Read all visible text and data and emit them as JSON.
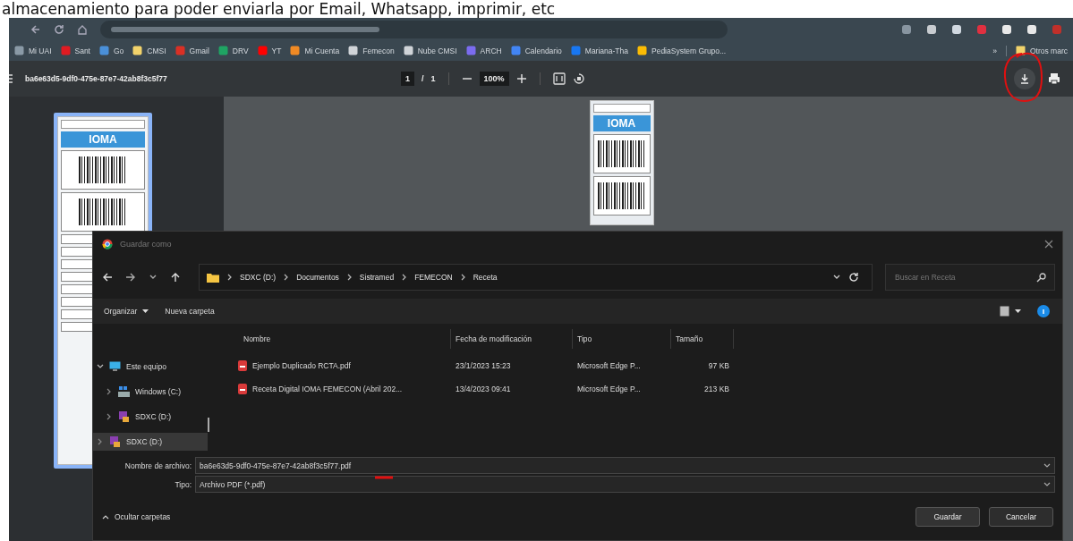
{
  "caption": "almacenamiento para poder enviarla por Email, Whatsapp, imprimir, etc",
  "bookmarks": [
    {
      "label": "Mi UAI",
      "color": "#8a9aa6"
    },
    {
      "label": "Sant",
      "color": "#e01b22"
    },
    {
      "label": "Go",
      "color": "#4a90d9"
    },
    {
      "label": "CMSI",
      "color": "#f2d36b"
    },
    {
      "label": "Gmail",
      "color": "#d93025"
    },
    {
      "label": "DRV",
      "color": "#1fa463"
    },
    {
      "label": "YT",
      "color": "#ff0000"
    },
    {
      "label": "Mi Cuenta",
      "color": "#f08a24"
    },
    {
      "label": "Femecon",
      "color": "#d0d4d8"
    },
    {
      "label": "Nube CMSI",
      "color": "#d0d4d8"
    },
    {
      "label": "ARCH",
      "color": "#7b6cf0"
    },
    {
      "label": "Calendario",
      "color": "#4285f4"
    },
    {
      "label": "Mariana-Tha",
      "color": "#1877f2"
    },
    {
      "label": "PediaSystem Grupo...",
      "color": "#fbbc04"
    }
  ],
  "bookmarks_more": "»",
  "other_bookmarks": "Otros marc",
  "pdf_toolbar": {
    "title": "ba6e63d5-9df0-475e-87e7-42ab8f3c5f77",
    "page_input": "1",
    "page_separator": "/",
    "page_total": "1",
    "zoom": "100%"
  },
  "document": {
    "header": "IOMA"
  },
  "thumbnail": {
    "header": "IOMA",
    "selected": true
  },
  "dialog": {
    "title": "Guardar como",
    "breadcrumb": [
      "SDXC (D:)",
      "Documentos",
      "Sistramed",
      "FEMECON",
      "Receta"
    ],
    "search": {
      "placeholder": "Buscar en Receta"
    },
    "commands": [
      "Organizar",
      "Nueva carpeta"
    ],
    "nav": [
      {
        "label": "Este equipo",
        "kind": "computer",
        "expanded": true,
        "selected": false,
        "children": [
          {
            "label": "Windows (C:)",
            "kind": "system",
            "expanded": false,
            "selected": false
          },
          {
            "label": "SDXC (D:)",
            "kind": "drive",
            "expanded": false,
            "selected": false
          }
        ]
      },
      {
        "label": "SDXC (D:)",
        "kind": "drive",
        "expanded": false,
        "selected": true
      }
    ],
    "columns": [
      "Nombre",
      "Fecha de modificación",
      "Tipo",
      "Tamaño"
    ],
    "files": [
      {
        "name": "Ejemplo Duplicado RCTA.pdf",
        "date": "23/1/2023 15:23",
        "type": "Microsoft Edge P...",
        "size": "97 KB"
      },
      {
        "name": "Receta Digital IOMA FEMECON (Abril 202...",
        "date": "13/4/2023 09:41",
        "type": "Microsoft Edge P...",
        "size": "213 KB"
      }
    ],
    "filename": {
      "label": "Nombre de archivo:",
      "value": "ba6e63d5-9df0-475e-87e7-42ab8f3c5f77.pdf"
    },
    "filetype": {
      "label": "Tipo:",
      "value": "Archivo PDF (*.pdf)"
    },
    "hide_folders": "Ocultar carpetas",
    "buttons": [
      "Guardar",
      "Cancelar"
    ]
  }
}
